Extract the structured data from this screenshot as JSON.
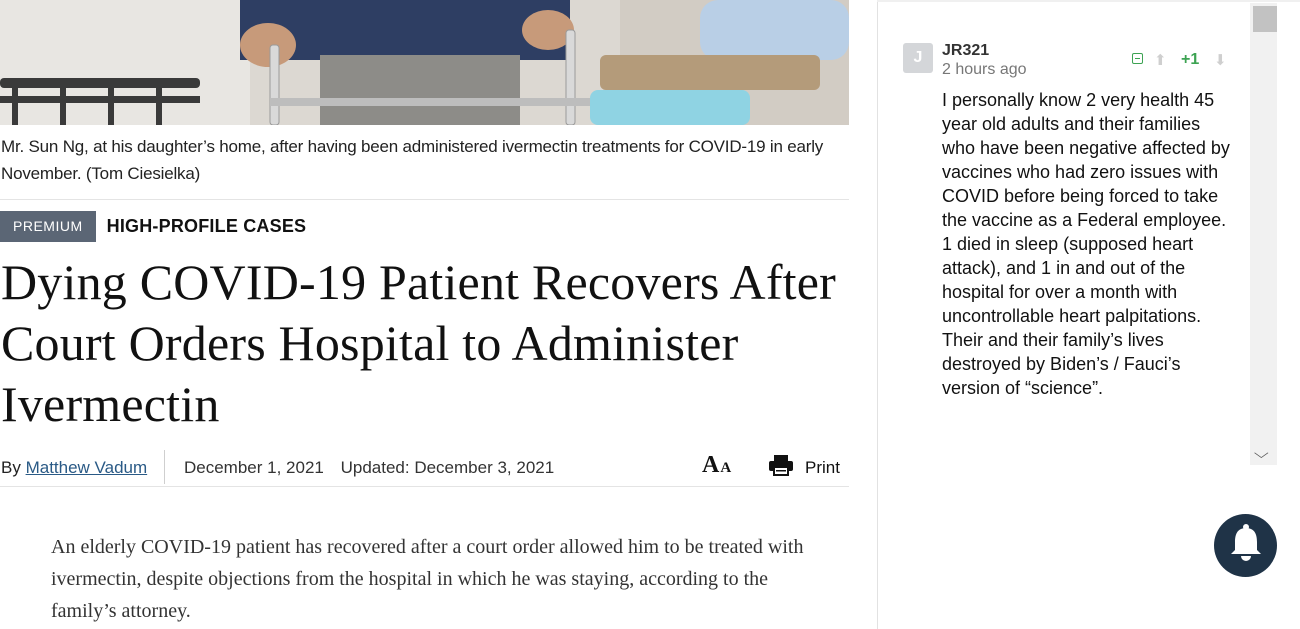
{
  "article": {
    "caption": "Mr. Sun Ng, at his daughter’s home, after having been administered ivermectin treatments for COVID-19 in early November. (Tom Ciesielka)",
    "badge": "PREMIUM",
    "category": "HIGH-PROFILE CASES",
    "headline": "Dying COVID-19 Patient Recovers After Court Orders Hospital to Administer Ivermectin",
    "byline_prefix": "By",
    "author": "Matthew Vadum",
    "published": "December 1, 2021",
    "updated": "Updated: December 3, 2021",
    "print_label": "Print",
    "lead": "An elderly COVID-19 patient has recovered after a court order allowed him to be treated with ivermectin, despite objections from the hospital in which he was staying, according to the family’s attorney."
  },
  "comment": {
    "avatar_letter": "J",
    "username": "JR321",
    "timestamp": "2 hours ago",
    "score": "+1",
    "body": "I personally know 2 very health 45 year old adults and their families who have been negative affected by vaccines who had zero issues with COVID before being forced to take the vaccine as a Federal employee. 1 died in sleep (supposed heart attack), and 1 in and out of the hospital for over a month with uncontrollable heart palpitations. Their and their family’s lives destroyed by Biden’s / Fauci’s version of “science”."
  },
  "icons": {
    "font_size": "font-size-icon",
    "print": "printer-icon",
    "collapse": "collapse-icon",
    "upvote": "upvote-icon",
    "downvote": "downvote-icon",
    "notifications": "bell-icon",
    "scroll_down": "chevron-down-icon"
  },
  "colors": {
    "badge_bg": "#5b6675",
    "author_link": "#2a5a86",
    "score_green": "#3da353",
    "bell_bg": "#1f3347"
  }
}
